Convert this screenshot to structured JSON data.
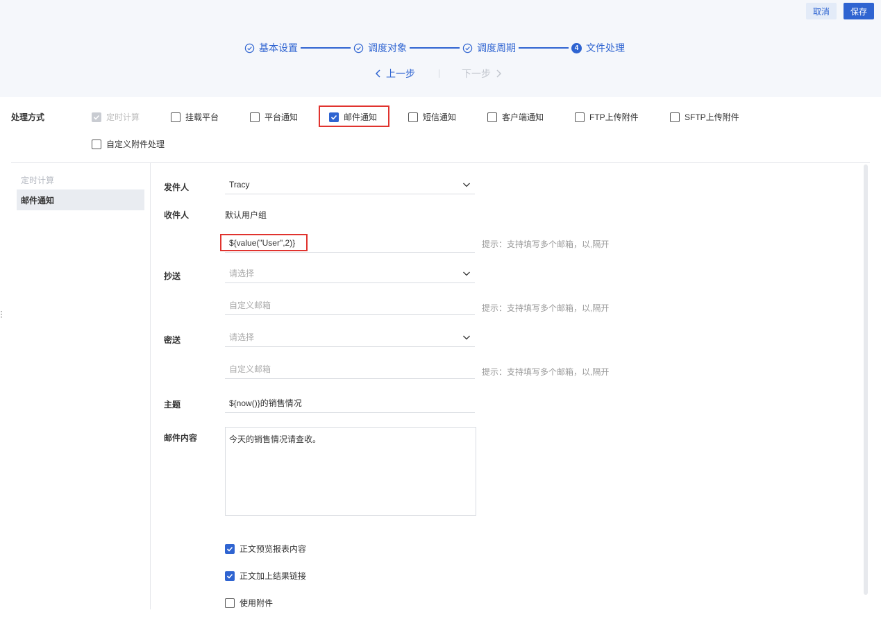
{
  "toolbar": {
    "cancel_label": "取消",
    "save_label": "保存"
  },
  "steps": [
    {
      "label": "基本设置",
      "state": "done"
    },
    {
      "label": "调度对象",
      "state": "done"
    },
    {
      "label": "调度周期",
      "state": "done"
    },
    {
      "label": "文件处理",
      "state": "active",
      "number": "4"
    }
  ],
  "pager": {
    "prev_label": "上一步",
    "next_label": "下一步"
  },
  "method": {
    "label": "处理方式",
    "options": [
      {
        "label": "定时计算",
        "checked": true,
        "disabled": true
      },
      {
        "label": "挂载平台",
        "checked": false
      },
      {
        "label": "平台通知",
        "checked": false
      },
      {
        "label": "邮件通知",
        "checked": true
      },
      {
        "label": "短信通知",
        "checked": false
      },
      {
        "label": "客户端通知",
        "checked": false
      },
      {
        "label": "FTP上传附件",
        "checked": false
      },
      {
        "label": "SFTP上传附件",
        "checked": false
      },
      {
        "label": "自定义附件处理",
        "checked": false
      }
    ]
  },
  "left_panel": {
    "title": "定时计算",
    "active_item": "邮件通知"
  },
  "form": {
    "sender": {
      "label": "发件人",
      "value": "Tracy"
    },
    "recipient": {
      "label": "收件人",
      "group": "默认用户组",
      "value": "${value(\"User\",2)}",
      "hint": "提示：支持填写多个邮箱，以,隔开"
    },
    "cc": {
      "label": "抄送",
      "select_placeholder": "请选择",
      "custom_placeholder": "自定义邮箱",
      "hint": "提示：支持填写多个邮箱，以,隔开"
    },
    "bcc": {
      "label": "密送",
      "select_placeholder": "请选择",
      "custom_placeholder": "自定义邮箱",
      "hint": "提示：支持填写多个邮箱，以,隔开"
    },
    "subject": {
      "label": "主题",
      "value": "${now()}的销售情况"
    },
    "content": {
      "label": "邮件内容",
      "value": "今天的销售情况请查收。"
    },
    "options": [
      {
        "label": "正文预览报表内容",
        "checked": true
      },
      {
        "label": "正文加上结果链接",
        "checked": true
      },
      {
        "label": "使用附件",
        "checked": false
      }
    ]
  },
  "colors": {
    "accent": "#2f64d1",
    "highlight": "#e0332e"
  }
}
